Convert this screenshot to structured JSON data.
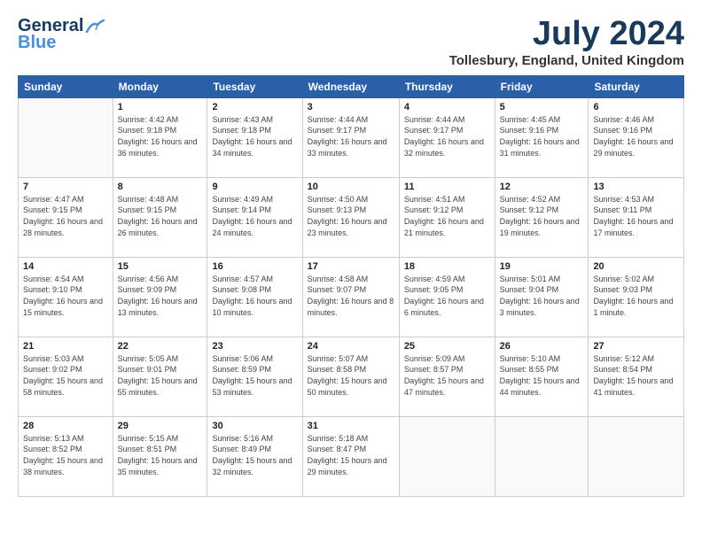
{
  "header": {
    "logo_line1": "General",
    "logo_line2": "Blue",
    "month": "July 2024",
    "location": "Tollesbury, England, United Kingdom"
  },
  "weekdays": [
    "Sunday",
    "Monday",
    "Tuesday",
    "Wednesday",
    "Thursday",
    "Friday",
    "Saturday"
  ],
  "weeks": [
    [
      {
        "day": "",
        "sunrise": "",
        "sunset": "",
        "daylight": ""
      },
      {
        "day": "1",
        "sunrise": "Sunrise: 4:42 AM",
        "sunset": "Sunset: 9:18 PM",
        "daylight": "Daylight: 16 hours and 36 minutes."
      },
      {
        "day": "2",
        "sunrise": "Sunrise: 4:43 AM",
        "sunset": "Sunset: 9:18 PM",
        "daylight": "Daylight: 16 hours and 34 minutes."
      },
      {
        "day": "3",
        "sunrise": "Sunrise: 4:44 AM",
        "sunset": "Sunset: 9:17 PM",
        "daylight": "Daylight: 16 hours and 33 minutes."
      },
      {
        "day": "4",
        "sunrise": "Sunrise: 4:44 AM",
        "sunset": "Sunset: 9:17 PM",
        "daylight": "Daylight: 16 hours and 32 minutes."
      },
      {
        "day": "5",
        "sunrise": "Sunrise: 4:45 AM",
        "sunset": "Sunset: 9:16 PM",
        "daylight": "Daylight: 16 hours and 31 minutes."
      },
      {
        "day": "6",
        "sunrise": "Sunrise: 4:46 AM",
        "sunset": "Sunset: 9:16 PM",
        "daylight": "Daylight: 16 hours and 29 minutes."
      }
    ],
    [
      {
        "day": "7",
        "sunrise": "Sunrise: 4:47 AM",
        "sunset": "Sunset: 9:15 PM",
        "daylight": "Daylight: 16 hours and 28 minutes."
      },
      {
        "day": "8",
        "sunrise": "Sunrise: 4:48 AM",
        "sunset": "Sunset: 9:15 PM",
        "daylight": "Daylight: 16 hours and 26 minutes."
      },
      {
        "day": "9",
        "sunrise": "Sunrise: 4:49 AM",
        "sunset": "Sunset: 9:14 PM",
        "daylight": "Daylight: 16 hours and 24 minutes."
      },
      {
        "day": "10",
        "sunrise": "Sunrise: 4:50 AM",
        "sunset": "Sunset: 9:13 PM",
        "daylight": "Daylight: 16 hours and 23 minutes."
      },
      {
        "day": "11",
        "sunrise": "Sunrise: 4:51 AM",
        "sunset": "Sunset: 9:12 PM",
        "daylight": "Daylight: 16 hours and 21 minutes."
      },
      {
        "day": "12",
        "sunrise": "Sunrise: 4:52 AM",
        "sunset": "Sunset: 9:12 PM",
        "daylight": "Daylight: 16 hours and 19 minutes."
      },
      {
        "day": "13",
        "sunrise": "Sunrise: 4:53 AM",
        "sunset": "Sunset: 9:11 PM",
        "daylight": "Daylight: 16 hours and 17 minutes."
      }
    ],
    [
      {
        "day": "14",
        "sunrise": "Sunrise: 4:54 AM",
        "sunset": "Sunset: 9:10 PM",
        "daylight": "Daylight: 16 hours and 15 minutes."
      },
      {
        "day": "15",
        "sunrise": "Sunrise: 4:56 AM",
        "sunset": "Sunset: 9:09 PM",
        "daylight": "Daylight: 16 hours and 13 minutes."
      },
      {
        "day": "16",
        "sunrise": "Sunrise: 4:57 AM",
        "sunset": "Sunset: 9:08 PM",
        "daylight": "Daylight: 16 hours and 10 minutes."
      },
      {
        "day": "17",
        "sunrise": "Sunrise: 4:58 AM",
        "sunset": "Sunset: 9:07 PM",
        "daylight": "Daylight: 16 hours and 8 minutes."
      },
      {
        "day": "18",
        "sunrise": "Sunrise: 4:59 AM",
        "sunset": "Sunset: 9:05 PM",
        "daylight": "Daylight: 16 hours and 6 minutes."
      },
      {
        "day": "19",
        "sunrise": "Sunrise: 5:01 AM",
        "sunset": "Sunset: 9:04 PM",
        "daylight": "Daylight: 16 hours and 3 minutes."
      },
      {
        "day": "20",
        "sunrise": "Sunrise: 5:02 AM",
        "sunset": "Sunset: 9:03 PM",
        "daylight": "Daylight: 16 hours and 1 minute."
      }
    ],
    [
      {
        "day": "21",
        "sunrise": "Sunrise: 5:03 AM",
        "sunset": "Sunset: 9:02 PM",
        "daylight": "Daylight: 15 hours and 58 minutes."
      },
      {
        "day": "22",
        "sunrise": "Sunrise: 5:05 AM",
        "sunset": "Sunset: 9:01 PM",
        "daylight": "Daylight: 15 hours and 55 minutes."
      },
      {
        "day": "23",
        "sunrise": "Sunrise: 5:06 AM",
        "sunset": "Sunset: 8:59 PM",
        "daylight": "Daylight: 15 hours and 53 minutes."
      },
      {
        "day": "24",
        "sunrise": "Sunrise: 5:07 AM",
        "sunset": "Sunset: 8:58 PM",
        "daylight": "Daylight: 15 hours and 50 minutes."
      },
      {
        "day": "25",
        "sunrise": "Sunrise: 5:09 AM",
        "sunset": "Sunset: 8:57 PM",
        "daylight": "Daylight: 15 hours and 47 minutes."
      },
      {
        "day": "26",
        "sunrise": "Sunrise: 5:10 AM",
        "sunset": "Sunset: 8:55 PM",
        "daylight": "Daylight: 15 hours and 44 minutes."
      },
      {
        "day": "27",
        "sunrise": "Sunrise: 5:12 AM",
        "sunset": "Sunset: 8:54 PM",
        "daylight": "Daylight: 15 hours and 41 minutes."
      }
    ],
    [
      {
        "day": "28",
        "sunrise": "Sunrise: 5:13 AM",
        "sunset": "Sunset: 8:52 PM",
        "daylight": "Daylight: 15 hours and 38 minutes."
      },
      {
        "day": "29",
        "sunrise": "Sunrise: 5:15 AM",
        "sunset": "Sunset: 8:51 PM",
        "daylight": "Daylight: 15 hours and 35 minutes."
      },
      {
        "day": "30",
        "sunrise": "Sunrise: 5:16 AM",
        "sunset": "Sunset: 8:49 PM",
        "daylight": "Daylight: 15 hours and 32 minutes."
      },
      {
        "day": "31",
        "sunrise": "Sunrise: 5:18 AM",
        "sunset": "Sunset: 8:47 PM",
        "daylight": "Daylight: 15 hours and 29 minutes."
      },
      {
        "day": "",
        "sunrise": "",
        "sunset": "",
        "daylight": ""
      },
      {
        "day": "",
        "sunrise": "",
        "sunset": "",
        "daylight": ""
      },
      {
        "day": "",
        "sunrise": "",
        "sunset": "",
        "daylight": ""
      }
    ]
  ]
}
